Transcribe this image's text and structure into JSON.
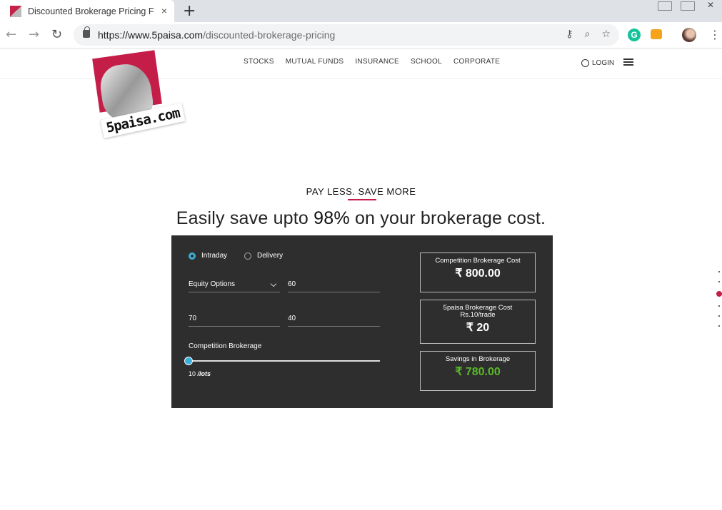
{
  "browser": {
    "tab_title": "Discounted Brokerage Pricing Fo",
    "new_tab": "+",
    "close_tab": "×",
    "url_host": "https://www.5paisa.com",
    "url_path": "/discounted-brokerage-pricing"
  },
  "site": {
    "nav": [
      "STOCKS",
      "MUTUAL FUNDS",
      "INSURANCE",
      "SCHOOL",
      "CORPORATE"
    ],
    "login": "LOGIN",
    "logo_text": "5paisa.com"
  },
  "hero": {
    "tagline": "PAY LESS. SAVE MORE",
    "headline_pre": "Easily save upto ",
    "headline_bold": "98%",
    "headline_post": " on your brokerage cost."
  },
  "calculator": {
    "radio_intraday": "Intraday",
    "radio_delivery": "Delivery",
    "segment": "Equity Options",
    "field_1": "60",
    "field_2": "70",
    "field_3": "40",
    "slider_label": "Competition Brokerage",
    "slider_value": "10",
    "slider_unit": "/lots",
    "competition_caption": "Competition Brokerage Cost",
    "competition_amount": "₹ 800.00",
    "fivepaisa_caption": "5paisa Brokerage Cost",
    "fivepaisa_sub": "Rs.10/trade",
    "fivepaisa_amount": "₹ 20",
    "savings_caption": "Savings in Brokerage",
    "savings_amount": "₹ 780.00"
  },
  "colors": {
    "brand": "#c41e48",
    "savings": "#5ab82a",
    "radio_active": "#3ab0d8"
  }
}
